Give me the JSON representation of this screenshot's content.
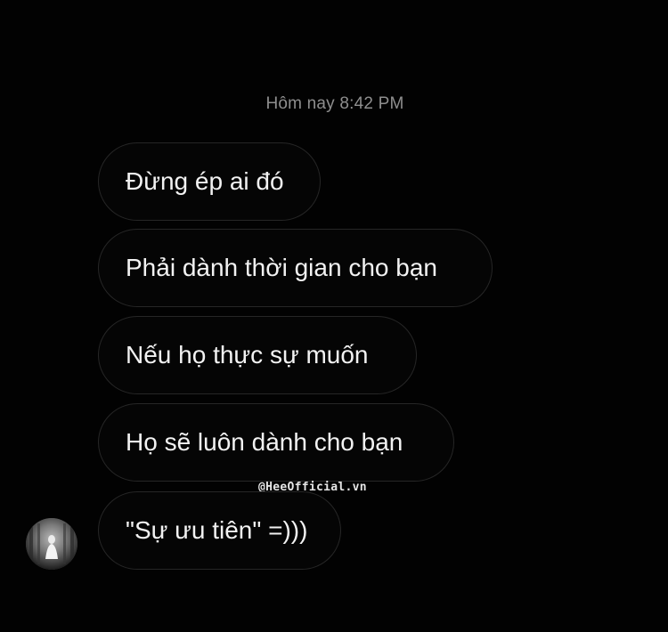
{
  "chat": {
    "timestamp": "Hôm nay 8:42 PM",
    "messages": [
      {
        "text": "Đừng ép ai đó"
      },
      {
        "text": "Phải dành thời gian cho bạn"
      },
      {
        "text": "Nếu họ thực sự muốn"
      },
      {
        "text": "Họ sẽ luôn dành cho bạn"
      },
      {
        "text": "\"Sự ưu tiên\" =)))"
      }
    ],
    "watermark": "@HeeOfficial.vn"
  },
  "icons": {
    "avatar": "profile-avatar"
  },
  "colors": {
    "background": "#020202",
    "bubble_border": "#262626",
    "timestamp_text": "#8e8e8e",
    "message_text": "#f2f2f2"
  }
}
